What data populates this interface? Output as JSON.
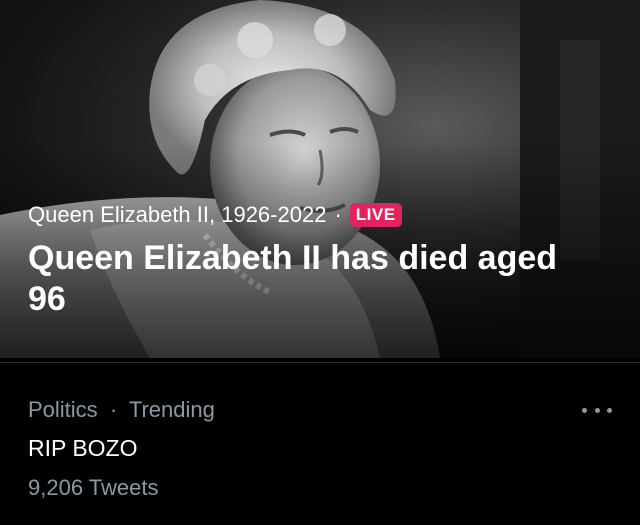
{
  "colors": {
    "live_badge": "#e0245e",
    "secondary_text": "#8b98a5",
    "background": "#000000",
    "divider": "#2f3336"
  },
  "hero": {
    "image": "black-and-white portrait of Queen Elizabeth II",
    "topic": "Queen Elizabeth II, 1926-2022",
    "separator": "·",
    "live_badge": "LIVE",
    "headline": "Queen Elizabeth II has died aged 96"
  },
  "trend": {
    "category": "Politics",
    "separator": "·",
    "status": "Trending",
    "title": "RIP BOZO",
    "tweet_count": "9,206 Tweets",
    "more_icon": "more-horizontal-icon"
  }
}
